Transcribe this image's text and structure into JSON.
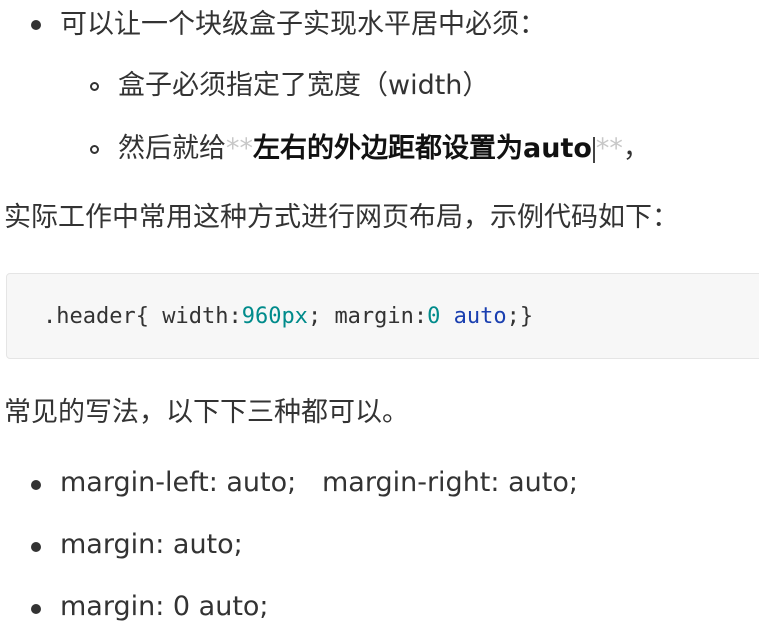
{
  "list1": {
    "item1": "可以让一个块级盒子实现水平居中必须：",
    "sub1": "盒子必须指定了宽度（width）",
    "sub2_prefix": "然后就给",
    "sub2_stars_open": "**",
    "sub2_bold": "左右的外边距都设置为auto",
    "sub2_stars_close": "**",
    "sub2_suffix": "，"
  },
  "paragraph1": "实际工作中常用这种方式进行网页布局，示例代码如下：",
  "code": {
    "selector": ".header{",
    "prop1": "width:",
    "num1": "960px",
    "semi1": ";",
    "prop2": "margin:",
    "num2": "0",
    "kw": "auto",
    "end": ";}"
  },
  "paragraph2": "常见的写法，以下下三种都可以。",
  "list2": {
    "item1": "margin-left: auto;   margin-right: auto;",
    "item2": "margin: auto;",
    "item3": "margin: 0 auto;"
  },
  "colors": {
    "text": "#333333",
    "stars": "#c8c8c8",
    "code_bg": "#f7f7f7",
    "code_number": "#008b8b",
    "code_keyword": "#1a3fb0"
  }
}
